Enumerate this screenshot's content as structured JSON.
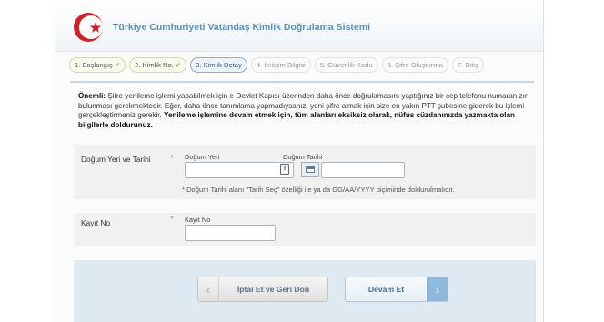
{
  "header": {
    "title": "Türkiye Cumhuriyeti Vatandaş Kimlik Doğrulama Sistemi",
    "logo": "crescent-star-logo"
  },
  "steps": [
    {
      "label": "1. Başlangıç",
      "state": "done"
    },
    {
      "label": "2. Kimlik No.",
      "state": "done"
    },
    {
      "label": "3. Kimlik Detay",
      "state": "active"
    },
    {
      "label": "4. İletişim Bilgisi",
      "state": "pending"
    },
    {
      "label": "5. Güvenlik Kodu",
      "state": "pending"
    },
    {
      "label": "6. Şifre Oluşturma",
      "state": "pending"
    },
    {
      "label": "7. Bitiş",
      "state": "pending"
    }
  ],
  "check_glyph": "✓",
  "info": {
    "lead": "Önemli:",
    "text": " Şifre yenileme işlemi yapabilmek için e-Devlet Kapısı üzerinden daha önce doğrulamasını yaptığınız bir cep telefonu numaranızın bulunması gerekmektedir. Eğer, daha önce tanımlama yapmadıysanız, yeni şifre almak için size en yakın PTT şubesine giderek bu işlemi gerçekleştirmeniz gerekir. ",
    "bold": "Yenileme işlemine devam etmek için, tüm alanları eksiksiz olarak, nüfus cüzdanınızda yazmakta olan bilgilerle doldurunuz."
  },
  "form": {
    "birth": {
      "row_label": "Doğum Yeri ve Tarihi",
      "place_label": "Doğum Yeri",
      "place_value": "",
      "date_label": "Doğum Tarihi",
      "date_value": "",
      "hint": "* Doğum Tarihi alanı \"Tarih Seç\" özelliği ile ya da GG/AA/YYYY biçiminde doldurulmalıdır."
    },
    "record": {
      "row_label": "Kayıt No",
      "field_label": "Kayıt No",
      "value": ""
    },
    "required_mark": "*"
  },
  "buttons": {
    "back_label": "İptal Et ve Geri Dön",
    "next_label": "Devam Et",
    "back_arrow": "‹",
    "next_arrow": "›"
  },
  "colors": {
    "title": "#5a8fb5",
    "accent": "#8fb9dc",
    "check": "#6bb32e",
    "logo_red": "#d0202a"
  }
}
